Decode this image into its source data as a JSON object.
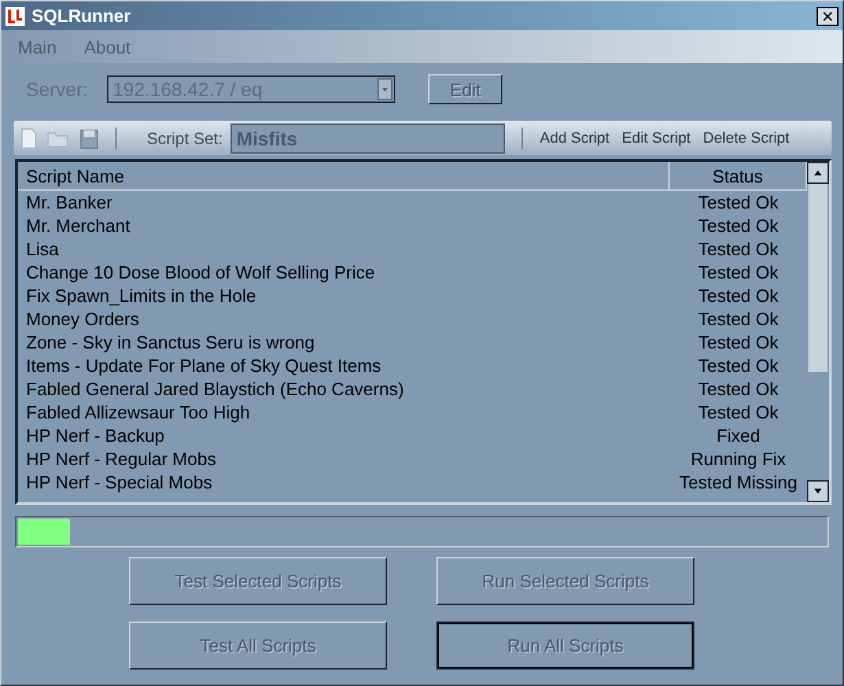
{
  "window": {
    "title": "SQLRunner",
    "close": "✕"
  },
  "menu": [
    "Main",
    "About"
  ],
  "server": {
    "label": "Server:",
    "value": "192.168.42.7 / eq",
    "disabled": true,
    "edit_button": {
      "label": "Edit",
      "disabled": true
    }
  },
  "toolbar": {
    "script_set_label": "Script Set:",
    "script_set_value": "Misfits",
    "actions": [
      "Add Script",
      "Edit Script",
      "Delete Script"
    ]
  },
  "table": {
    "columns": [
      "Script Name",
      "Status"
    ],
    "rows": [
      {
        "name": "Mr. Banker",
        "status": "Tested Ok"
      },
      {
        "name": "Mr. Merchant",
        "status": "Tested Ok"
      },
      {
        "name": "Lisa",
        "status": "Tested Ok"
      },
      {
        "name": "Change 10 Dose Blood of Wolf Selling Price",
        "status": "Tested Ok"
      },
      {
        "name": "Fix Spawn_Limits in the Hole",
        "status": "Tested Ok"
      },
      {
        "name": "Money Orders",
        "status": "Tested Ok"
      },
      {
        "name": "Zone - Sky in Sanctus Seru is wrong",
        "status": "Tested Ok"
      },
      {
        "name": "Items - Update For Plane of Sky Quest Items",
        "status": "Tested Ok"
      },
      {
        "name": "Fabled General Jared Blaystich (Echo Caverns)",
        "status": "Tested Ok"
      },
      {
        "name": "Fabled Allizewsaur Too High",
        "status": "Tested Ok"
      },
      {
        "name": "HP Nerf - Backup",
        "status": "Fixed"
      },
      {
        "name": "HP Nerf - Regular Mobs",
        "status": "Running Fix"
      },
      {
        "name": "HP Nerf - Special Mobs",
        "status": "Tested Missing"
      }
    ]
  },
  "progress": {
    "level": 0.065
  },
  "buttons": [
    {
      "label": "Test Selected Scripts",
      "disabled": true,
      "default": false
    },
    {
      "label": "Run Selected Scripts",
      "disabled": true,
      "default": false
    },
    {
      "label": "Test All Scripts",
      "disabled": true,
      "default": false
    },
    {
      "label": "Run All Scripts",
      "disabled": true,
      "default": true
    }
  ]
}
